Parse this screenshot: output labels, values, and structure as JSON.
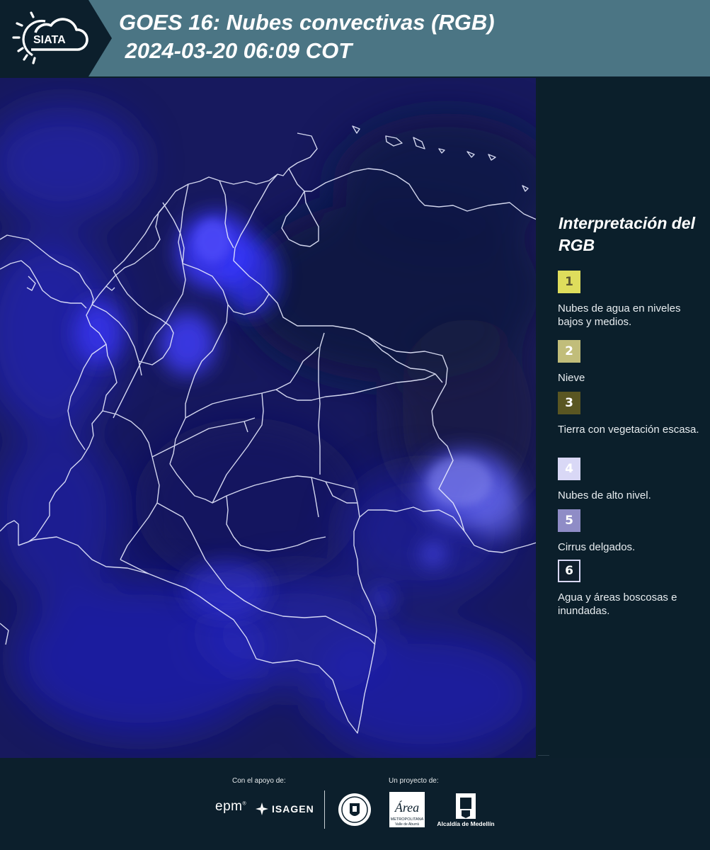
{
  "header": {
    "logo_text": "SIATA",
    "title_line1": "GOES 16: Nubes convectivas (RGB)",
    "title_line2": " 2024-03-20 06:09 COT",
    "background_color": "#4b7584"
  },
  "map": {
    "description_icon": "satellite-imagery-colombia",
    "base_color": "#161a5c",
    "cloud_color": "#3530ff",
    "border_color": "#ffffff"
  },
  "legend": {
    "title": "Interpretación del RGB",
    "items": [
      {
        "number": "1",
        "label": "Nubes de agua en niveles bajos y medios.",
        "color": "#dedd5c",
        "text_color": "#5a5630"
      },
      {
        "number": "2",
        "label": "Nieve",
        "color": "#c1bd7a",
        "text_color": "#ffffff"
      },
      {
        "number": "3",
        "label": "Tierra con vegetación escasa.",
        "color": "#5a5622",
        "text_color": "#ffffff"
      },
      {
        "number": "4",
        "label": "Nubes de alto nivel.",
        "color": "#d9d8f6",
        "text_color": "#ffffff"
      },
      {
        "number": "5",
        "label": "Cirrus delgados.",
        "color": "#8f8cc6",
        "text_color": "#ffffff"
      },
      {
        "number": "6",
        "label": "Agua y áreas boscosas e inundadas.",
        "color": "#101e2c",
        "text_color": "#ffffff"
      }
    ]
  },
  "footer": {
    "support_label": "Con el apoyo de:",
    "project_label": "Un proyecto de:",
    "sponsors": [
      "epm",
      "ISAGEN"
    ],
    "partners_text": [
      "Área",
      "METROPOLITANA",
      "Valle de Aburrá",
      "Alcaldía de Medellín"
    ]
  }
}
